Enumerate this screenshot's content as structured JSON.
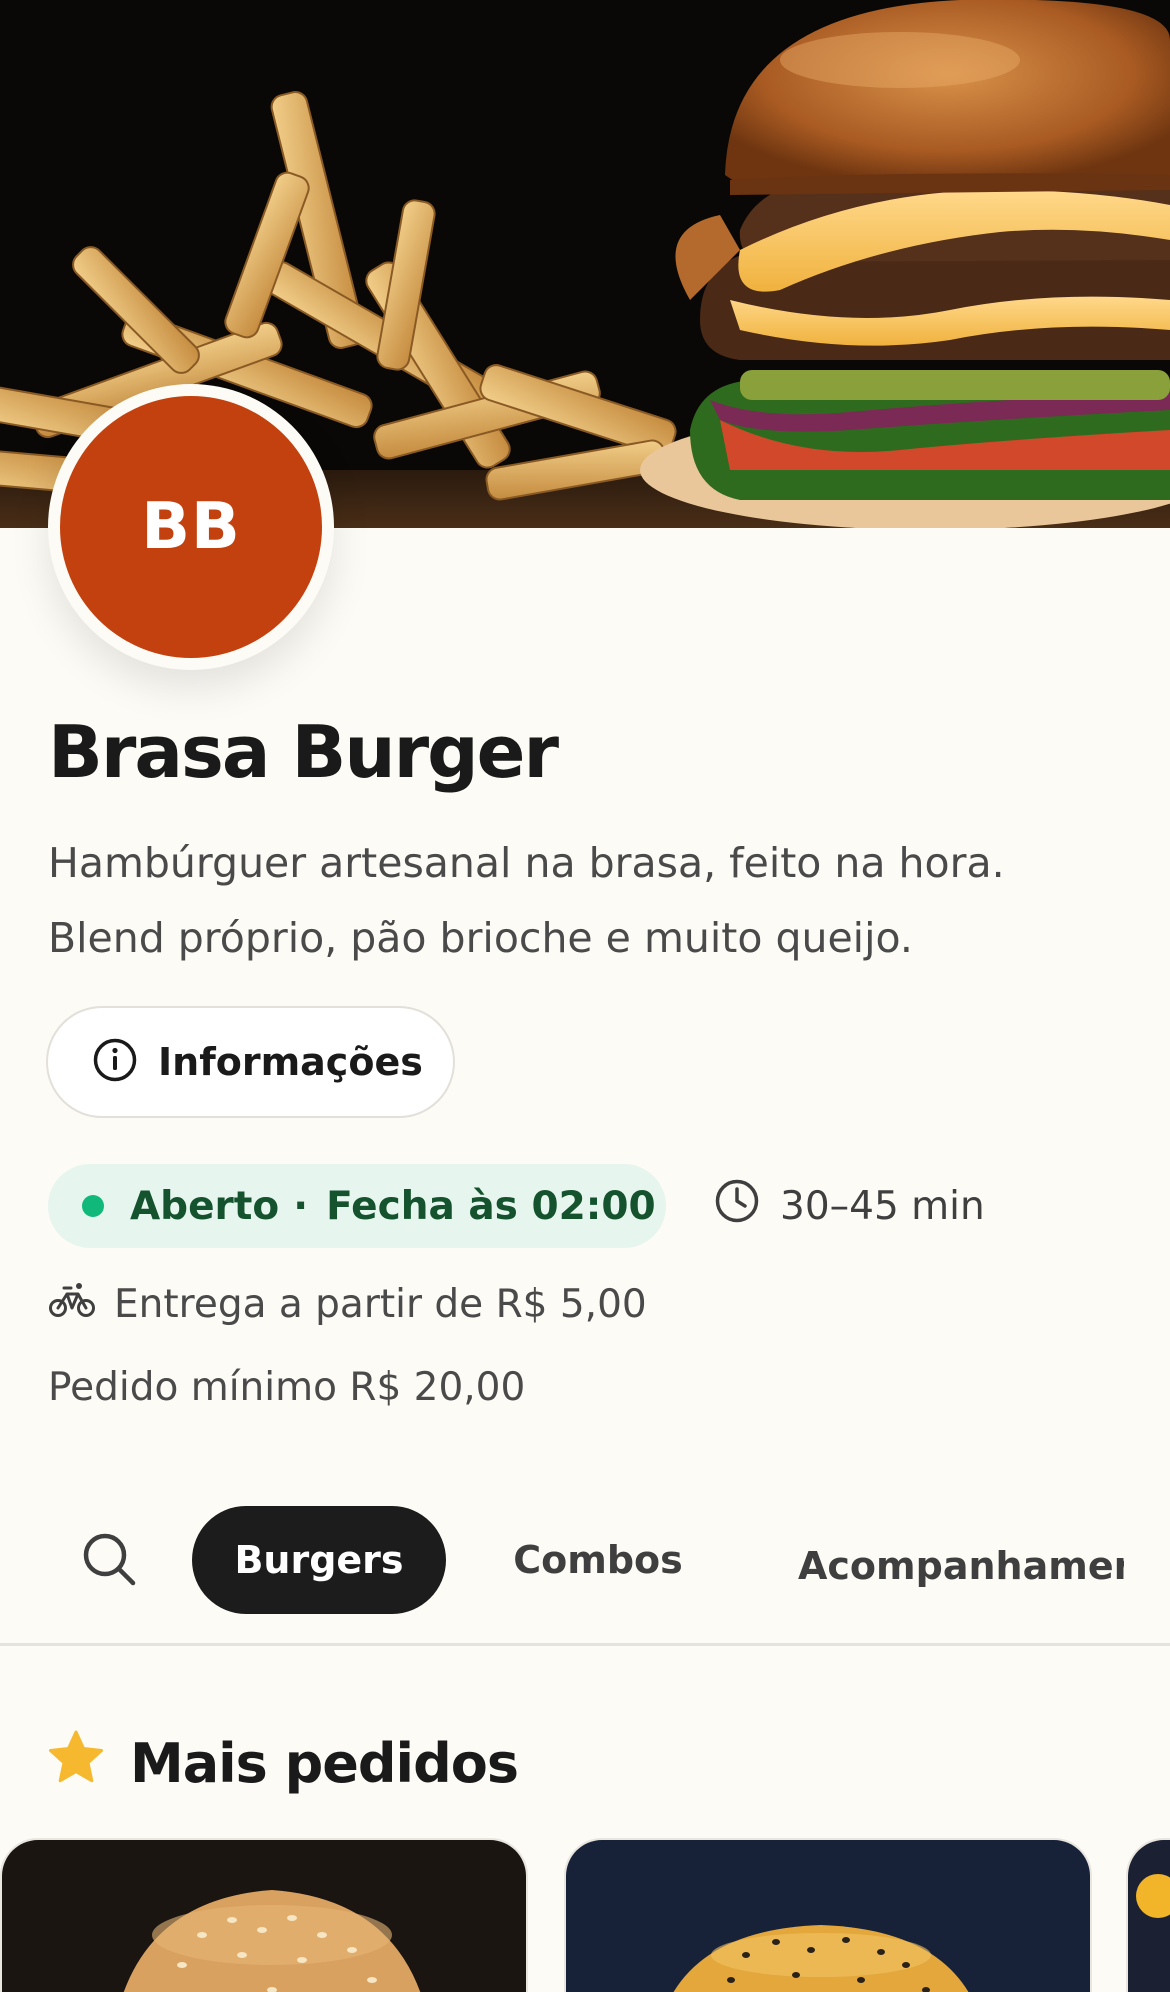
{
  "hero": {
    "image": "burger-and-fries-photo"
  },
  "store": {
    "avatar_initials": "BB",
    "name": "Brasa Burger",
    "description_line1": "Hambúrguer artesanal na brasa, feito na hora.",
    "description_line2": "Blend próprio, pão brioche e muito queijo."
  },
  "info_button": {
    "label": "Informações",
    "icon": "info-icon"
  },
  "status": {
    "open_label": "Aberto",
    "separator": "·",
    "closes_label": "Fecha às 02:00",
    "delivery_time": "30–45 min",
    "delivery_fee": "Entrega a partir de R$ 5,00",
    "minimum_order": "Pedido mínimo R$ 20,00"
  },
  "tabs": {
    "search_icon": "search-icon",
    "items": [
      {
        "label": "Burgers",
        "active": true
      },
      {
        "label": "Combos",
        "active": false
      },
      {
        "label": "Acompanhamentos",
        "active": false
      }
    ]
  },
  "section": {
    "title": "Mais pedidos",
    "icon": "star-icon"
  },
  "colors": {
    "accent": "#c2410f",
    "background": "#fdfbf6",
    "open_green": "#10b97a",
    "open_text": "#14532d",
    "star": "#f5b82e",
    "tab_active": "#1c1c1c"
  }
}
